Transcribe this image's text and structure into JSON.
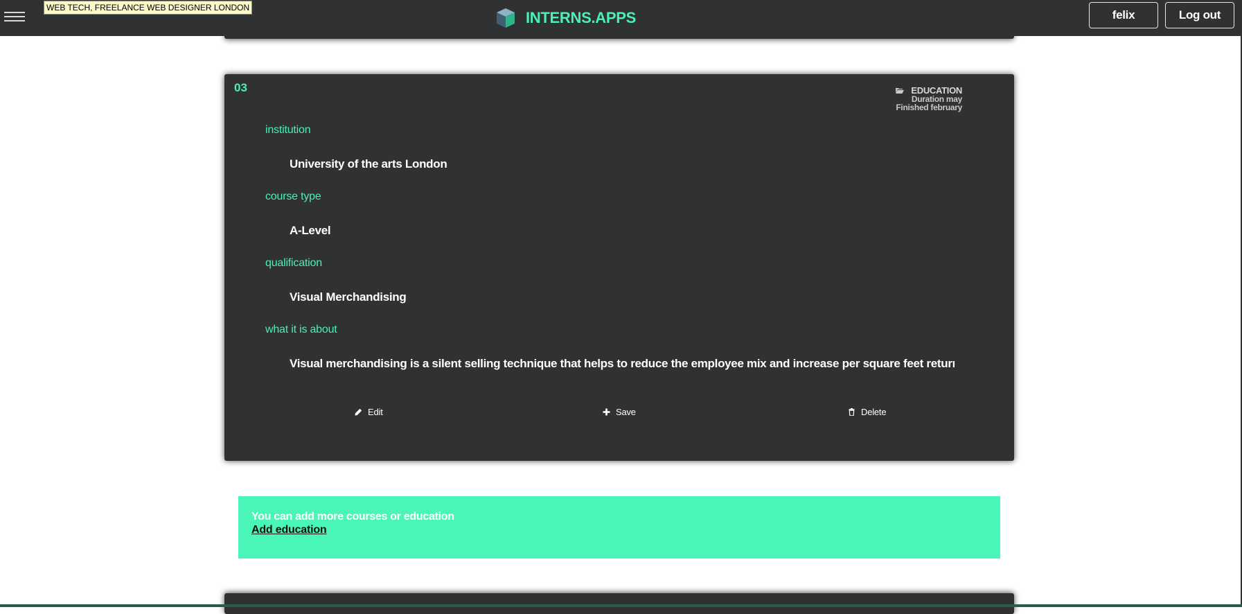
{
  "tooltip": "WEB TECH, FREELANCE WEB DESIGNER LONDON",
  "header": {
    "brand": "INTERNS.APPS",
    "user_button": "felix",
    "logout_button": "Log out"
  },
  "card": {
    "number": "03",
    "meta": {
      "category": "EDUCATION",
      "duration": "Duration may",
      "finished": "Finished february"
    },
    "fields": [
      {
        "label": "institution",
        "value": "University of the arts London"
      },
      {
        "label": "course type",
        "value": "A-Level"
      },
      {
        "label": "qualification",
        "value": "Visual Merchandising"
      },
      {
        "label": "what it is about",
        "value": "Visual merchandising is a silent selling technique that helps to reduce the employee mix and increase per square feet returns a"
      }
    ],
    "actions": {
      "edit": "Edit",
      "save": "Save",
      "delete": "Delete"
    }
  },
  "notice": {
    "text": "You can add more courses or education",
    "link": "Add education"
  },
  "colors": {
    "accent": "#4af0b6",
    "dark": "#2f3133",
    "notice_bg": "#4af5b8"
  }
}
